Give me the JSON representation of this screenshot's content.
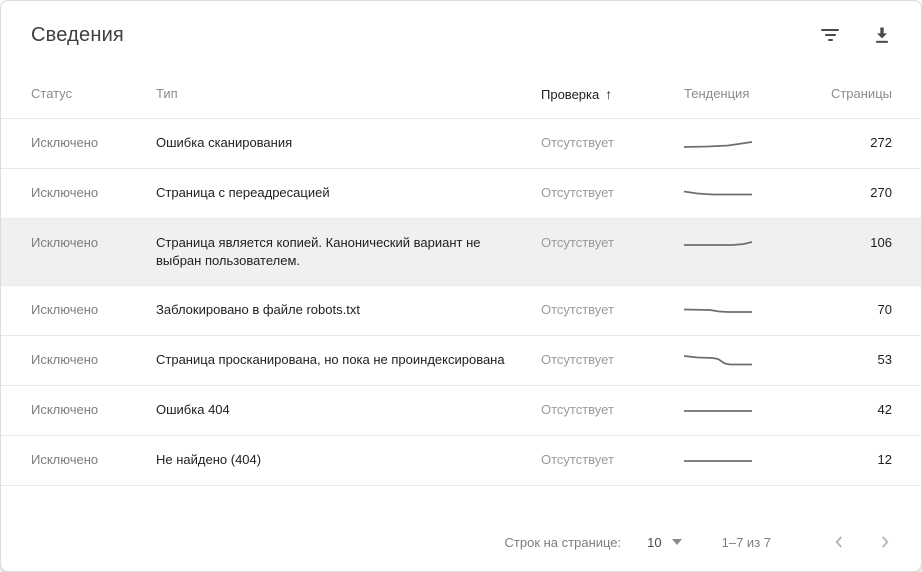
{
  "header": {
    "title": "Сведения"
  },
  "toolbar": {
    "filter_icon": "filter-list",
    "download_icon": "file-download"
  },
  "table": {
    "columns": [
      {
        "key": "status",
        "label": "Статус"
      },
      {
        "key": "type",
        "label": "Тип"
      },
      {
        "key": "verification",
        "label": "Проверка",
        "sorted": true,
        "sort_arrow": "↑",
        "sort_direction": "asc"
      },
      {
        "key": "trend",
        "label": "Тенденция"
      },
      {
        "key": "pages",
        "label": "Страницы"
      }
    ],
    "rows": [
      {
        "status": "Исключено",
        "type": "Ошибка сканирования",
        "verification": "Отсутствует",
        "pages": "272",
        "highlighted": false,
        "trend": [
          [
            0,
            14
          ],
          [
            35,
            13.5
          ],
          [
            65,
            12.5
          ],
          [
            85,
            10.5
          ],
          [
            100,
            9
          ]
        ]
      },
      {
        "status": "Исключено",
        "type": "Страница с переадресацией",
        "verification": "Отсутствует",
        "pages": "270",
        "highlighted": false,
        "trend": [
          [
            0,
            8.5
          ],
          [
            20,
            10.5
          ],
          [
            42,
            11.5
          ],
          [
            100,
            11.5
          ]
        ]
      },
      {
        "status": "Исключено",
        "type": "Страница является копией. Канонический вариант не выбран пользователем.",
        "verification": "Отсутствует",
        "pages": "106",
        "highlighted": true,
        "trend": [
          [
            0,
            12
          ],
          [
            72,
            12
          ],
          [
            88,
            11
          ],
          [
            100,
            9
          ]
        ]
      },
      {
        "status": "Исключено",
        "type": "Заблокировано в файле robots.txt",
        "verification": "Отсутствует",
        "pages": "70",
        "highlighted": false,
        "trend": [
          [
            0,
            9.5
          ],
          [
            38,
            10
          ],
          [
            52,
            11.5
          ],
          [
            65,
            12
          ],
          [
            100,
            12
          ]
        ]
      },
      {
        "status": "Исключено",
        "type": "Страница просканирована, но пока не проиндексирована",
        "verification": "Отсутствует",
        "pages": "53",
        "highlighted": false,
        "trend": [
          [
            0,
            6
          ],
          [
            20,
            7.5
          ],
          [
            42,
            8
          ],
          [
            50,
            9
          ],
          [
            60,
            13.5
          ],
          [
            68,
            14.5
          ],
          [
            100,
            14.5
          ]
        ]
      },
      {
        "status": "Исключено",
        "type": "Ошибка 404",
        "verification": "Отсутствует",
        "pages": "42",
        "highlighted": false,
        "trend": [
          [
            0,
            11
          ],
          [
            100,
            11
          ]
        ]
      },
      {
        "status": "Исключено",
        "type": "Не найдено (404)",
        "verification": "Отсутствует",
        "pages": "12",
        "highlighted": false,
        "trend": [
          [
            0,
            11
          ],
          [
            100,
            11
          ]
        ]
      }
    ]
  },
  "footer": {
    "rows_per_page_label": "Строк на странице:",
    "rows_per_page_value": "10",
    "range_label": "1–7 из 7",
    "prev_icon": "chevron-left",
    "next_icon": "chevron-right"
  },
  "colors": {
    "row_highlight": "#f0f0f0",
    "divider": "#e9e9e9",
    "sparkline": "#6e6e6e",
    "text_primary": "#212121",
    "text_secondary": "#8b8b8b",
    "icon": "#4a4a4a",
    "pager_disabled": "#b5b5b5"
  }
}
